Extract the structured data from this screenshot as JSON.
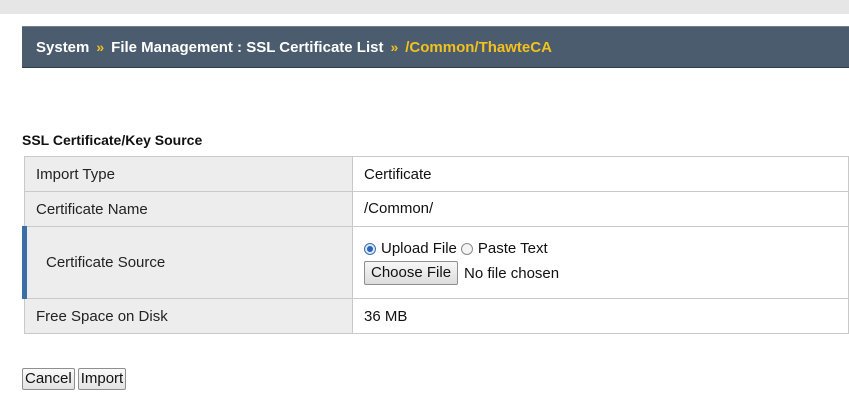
{
  "breadcrumb": {
    "items": [
      "System",
      "File Management : SSL Certificate List"
    ],
    "separator": "»",
    "current": "/Common/ThawteCA"
  },
  "section": {
    "title": "SSL Certificate/Key Source"
  },
  "form": {
    "import_type": {
      "label": "Import Type",
      "value": "Certificate"
    },
    "certificate_name": {
      "label": "Certificate Name",
      "value": "/Common/"
    },
    "certificate_source": {
      "label": "Certificate Source",
      "options": [
        "Upload File",
        "Paste Text"
      ],
      "selected": "Upload File",
      "choose_button": "Choose File",
      "file_status": "No file chosen"
    },
    "free_space": {
      "label": "Free Space on Disk",
      "value": "36 MB"
    }
  },
  "actions": {
    "cancel": "Cancel",
    "import": "Import"
  },
  "colors": {
    "breadcrumb_bg": "#4a5c6e",
    "breadcrumb_current": "#f3c11e",
    "required_marker": "#3b6fa5"
  }
}
